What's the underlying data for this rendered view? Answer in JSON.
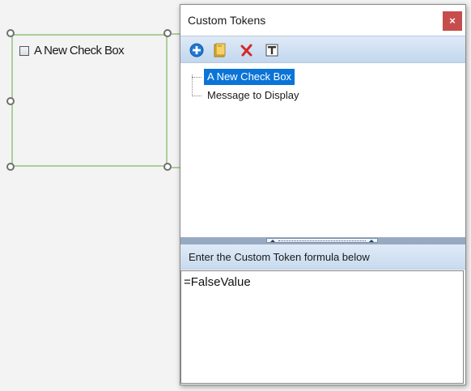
{
  "canvas": {
    "checkbox_label": "A New Check Box",
    "selection_color": "#a9cf99"
  },
  "window": {
    "title": "Custom Tokens",
    "close_label": "×",
    "close_color": "#c74d4d",
    "toolbar": {
      "add_icon": "add-circle-icon",
      "folder_icon": "folder-icon",
      "delete_icon": "delete-x-icon",
      "rename_icon": "rename-text-icon"
    },
    "tree": {
      "items": [
        {
          "label": "A New Check Box",
          "selected": true
        },
        {
          "label": "Message to Display",
          "selected": false
        }
      ],
      "selection_color": "#0a74d8"
    },
    "formula": {
      "header": "Enter the Custom Token formula below",
      "value": "=FalseValue"
    }
  }
}
